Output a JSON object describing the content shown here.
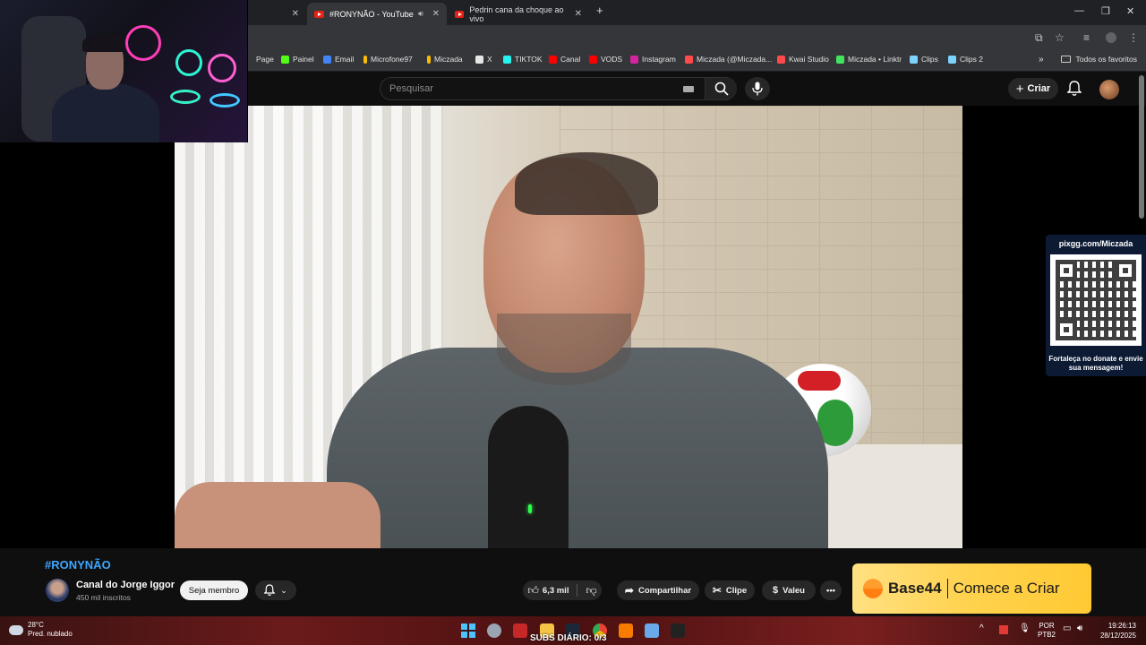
{
  "browser": {
    "tabs": [
      {
        "label": "#RONYNÃO - YouTube",
        "active": true
      },
      {
        "label": "Pedrin cana da choque ao vivo",
        "active": false
      }
    ],
    "new_tab_icon": "plus-icon",
    "window_controls": [
      "minimize-icon",
      "restore-icon",
      "close-icon"
    ]
  },
  "bookmarks": [
    {
      "label": "Page",
      "color": "#cfcfcf"
    },
    {
      "label": "Painel",
      "color": "#53fc18"
    },
    {
      "label": "Email",
      "color": "#4285f4"
    },
    {
      "label": "Microfone97",
      "color": "#fbbc04"
    },
    {
      "label": "Miczada",
      "color": "#fbbc04"
    },
    {
      "label": "X",
      "color": "#e7e7e7"
    },
    {
      "label": "TIKTOK",
      "color": "#25f4ee"
    },
    {
      "label": "Canal",
      "color": "#ff0000"
    },
    {
      "label": "VODS",
      "color": "#ff0000"
    },
    {
      "label": "Instagram",
      "color": "#d6249f"
    },
    {
      "label": "Miczada (@Miczada...",
      "color": "#ff4b4b"
    },
    {
      "label": "Kwai Studio",
      "color": "#ff4b4b"
    },
    {
      "label": "Miczada • Linktr",
      "color": "#43e55e"
    },
    {
      "label": "Clips",
      "color": "#7dd3fc"
    },
    {
      "label": "Clips 2",
      "color": "#7dd3fc"
    }
  ],
  "bookmarks_all": "Todos os favoritos",
  "youtube": {
    "search_placeholder": "Pesquisar",
    "create_label": "Criar"
  },
  "overlay": {
    "qr_url": "pixgg.com/Miczada",
    "qr_caption": "Fortaleça no donate e envie sua mensagem!"
  },
  "video": {
    "title": "#RONYNÃO",
    "channel": "Canal do Jorge Iggor",
    "subscribers": "450 mil inscritos",
    "member_label": "Seja membro",
    "likes": "6,3 mil",
    "share_label": "Compartilhar",
    "clip_label": "Clipe",
    "thanks_label": "Valeu"
  },
  "ad": {
    "brand": "Base44",
    "cta": "Comece a Criar",
    "accent": "#ffd24d"
  },
  "taskbar": {
    "temperature": "28°C",
    "weather": "Pred. nublado",
    "subs_counter": "SUBS DIÁRIO: 0/3",
    "lang_top": "POR",
    "lang_bottom": "PTB2",
    "time": "19:26:13",
    "date": "28/12/2025"
  }
}
